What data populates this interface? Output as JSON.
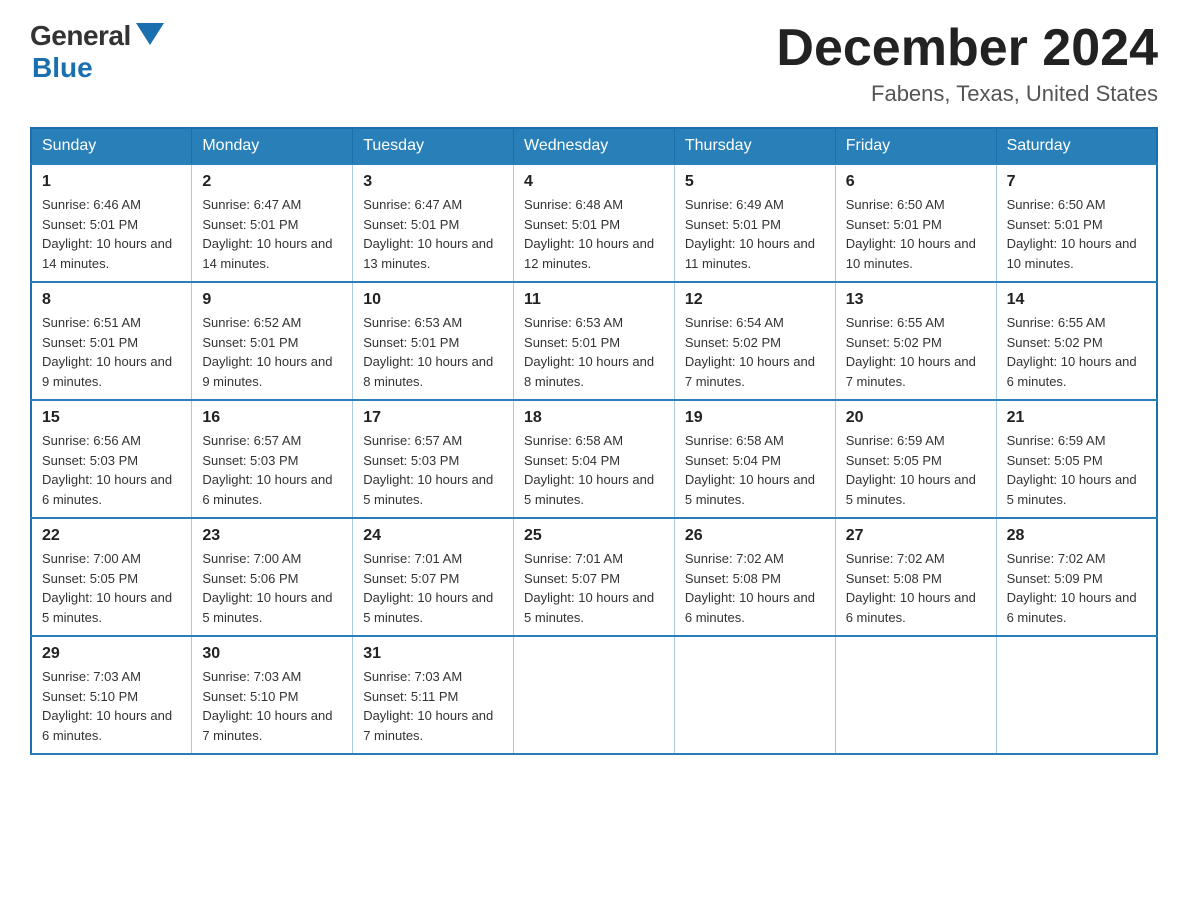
{
  "logo": {
    "general": "General",
    "blue": "Blue",
    "arrow_color": "#1a6faf"
  },
  "header": {
    "month_title": "December 2024",
    "location": "Fabens, Texas, United States"
  },
  "days_of_week": [
    "Sunday",
    "Monday",
    "Tuesday",
    "Wednesday",
    "Thursday",
    "Friday",
    "Saturday"
  ],
  "weeks": [
    [
      {
        "day": "1",
        "sunrise": "Sunrise: 6:46 AM",
        "sunset": "Sunset: 5:01 PM",
        "daylight": "Daylight: 10 hours and 14 minutes."
      },
      {
        "day": "2",
        "sunrise": "Sunrise: 6:47 AM",
        "sunset": "Sunset: 5:01 PM",
        "daylight": "Daylight: 10 hours and 14 minutes."
      },
      {
        "day": "3",
        "sunrise": "Sunrise: 6:47 AM",
        "sunset": "Sunset: 5:01 PM",
        "daylight": "Daylight: 10 hours and 13 minutes."
      },
      {
        "day": "4",
        "sunrise": "Sunrise: 6:48 AM",
        "sunset": "Sunset: 5:01 PM",
        "daylight": "Daylight: 10 hours and 12 minutes."
      },
      {
        "day": "5",
        "sunrise": "Sunrise: 6:49 AM",
        "sunset": "Sunset: 5:01 PM",
        "daylight": "Daylight: 10 hours and 11 minutes."
      },
      {
        "day": "6",
        "sunrise": "Sunrise: 6:50 AM",
        "sunset": "Sunset: 5:01 PM",
        "daylight": "Daylight: 10 hours and 10 minutes."
      },
      {
        "day": "7",
        "sunrise": "Sunrise: 6:50 AM",
        "sunset": "Sunset: 5:01 PM",
        "daylight": "Daylight: 10 hours and 10 minutes."
      }
    ],
    [
      {
        "day": "8",
        "sunrise": "Sunrise: 6:51 AM",
        "sunset": "Sunset: 5:01 PM",
        "daylight": "Daylight: 10 hours and 9 minutes."
      },
      {
        "day": "9",
        "sunrise": "Sunrise: 6:52 AM",
        "sunset": "Sunset: 5:01 PM",
        "daylight": "Daylight: 10 hours and 9 minutes."
      },
      {
        "day": "10",
        "sunrise": "Sunrise: 6:53 AM",
        "sunset": "Sunset: 5:01 PM",
        "daylight": "Daylight: 10 hours and 8 minutes."
      },
      {
        "day": "11",
        "sunrise": "Sunrise: 6:53 AM",
        "sunset": "Sunset: 5:01 PM",
        "daylight": "Daylight: 10 hours and 8 minutes."
      },
      {
        "day": "12",
        "sunrise": "Sunrise: 6:54 AM",
        "sunset": "Sunset: 5:02 PM",
        "daylight": "Daylight: 10 hours and 7 minutes."
      },
      {
        "day": "13",
        "sunrise": "Sunrise: 6:55 AM",
        "sunset": "Sunset: 5:02 PM",
        "daylight": "Daylight: 10 hours and 7 minutes."
      },
      {
        "day": "14",
        "sunrise": "Sunrise: 6:55 AM",
        "sunset": "Sunset: 5:02 PM",
        "daylight": "Daylight: 10 hours and 6 minutes."
      }
    ],
    [
      {
        "day": "15",
        "sunrise": "Sunrise: 6:56 AM",
        "sunset": "Sunset: 5:03 PM",
        "daylight": "Daylight: 10 hours and 6 minutes."
      },
      {
        "day": "16",
        "sunrise": "Sunrise: 6:57 AM",
        "sunset": "Sunset: 5:03 PM",
        "daylight": "Daylight: 10 hours and 6 minutes."
      },
      {
        "day": "17",
        "sunrise": "Sunrise: 6:57 AM",
        "sunset": "Sunset: 5:03 PM",
        "daylight": "Daylight: 10 hours and 5 minutes."
      },
      {
        "day": "18",
        "sunrise": "Sunrise: 6:58 AM",
        "sunset": "Sunset: 5:04 PM",
        "daylight": "Daylight: 10 hours and 5 minutes."
      },
      {
        "day": "19",
        "sunrise": "Sunrise: 6:58 AM",
        "sunset": "Sunset: 5:04 PM",
        "daylight": "Daylight: 10 hours and 5 minutes."
      },
      {
        "day": "20",
        "sunrise": "Sunrise: 6:59 AM",
        "sunset": "Sunset: 5:05 PM",
        "daylight": "Daylight: 10 hours and 5 minutes."
      },
      {
        "day": "21",
        "sunrise": "Sunrise: 6:59 AM",
        "sunset": "Sunset: 5:05 PM",
        "daylight": "Daylight: 10 hours and 5 minutes."
      }
    ],
    [
      {
        "day": "22",
        "sunrise": "Sunrise: 7:00 AM",
        "sunset": "Sunset: 5:05 PM",
        "daylight": "Daylight: 10 hours and 5 minutes."
      },
      {
        "day": "23",
        "sunrise": "Sunrise: 7:00 AM",
        "sunset": "Sunset: 5:06 PM",
        "daylight": "Daylight: 10 hours and 5 minutes."
      },
      {
        "day": "24",
        "sunrise": "Sunrise: 7:01 AM",
        "sunset": "Sunset: 5:07 PM",
        "daylight": "Daylight: 10 hours and 5 minutes."
      },
      {
        "day": "25",
        "sunrise": "Sunrise: 7:01 AM",
        "sunset": "Sunset: 5:07 PM",
        "daylight": "Daylight: 10 hours and 5 minutes."
      },
      {
        "day": "26",
        "sunrise": "Sunrise: 7:02 AM",
        "sunset": "Sunset: 5:08 PM",
        "daylight": "Daylight: 10 hours and 6 minutes."
      },
      {
        "day": "27",
        "sunrise": "Sunrise: 7:02 AM",
        "sunset": "Sunset: 5:08 PM",
        "daylight": "Daylight: 10 hours and 6 minutes."
      },
      {
        "day": "28",
        "sunrise": "Sunrise: 7:02 AM",
        "sunset": "Sunset: 5:09 PM",
        "daylight": "Daylight: 10 hours and 6 minutes."
      }
    ],
    [
      {
        "day": "29",
        "sunrise": "Sunrise: 7:03 AM",
        "sunset": "Sunset: 5:10 PM",
        "daylight": "Daylight: 10 hours and 6 minutes."
      },
      {
        "day": "30",
        "sunrise": "Sunrise: 7:03 AM",
        "sunset": "Sunset: 5:10 PM",
        "daylight": "Daylight: 10 hours and 7 minutes."
      },
      {
        "day": "31",
        "sunrise": "Sunrise: 7:03 AM",
        "sunset": "Sunset: 5:11 PM",
        "daylight": "Daylight: 10 hours and 7 minutes."
      },
      null,
      null,
      null,
      null
    ]
  ]
}
